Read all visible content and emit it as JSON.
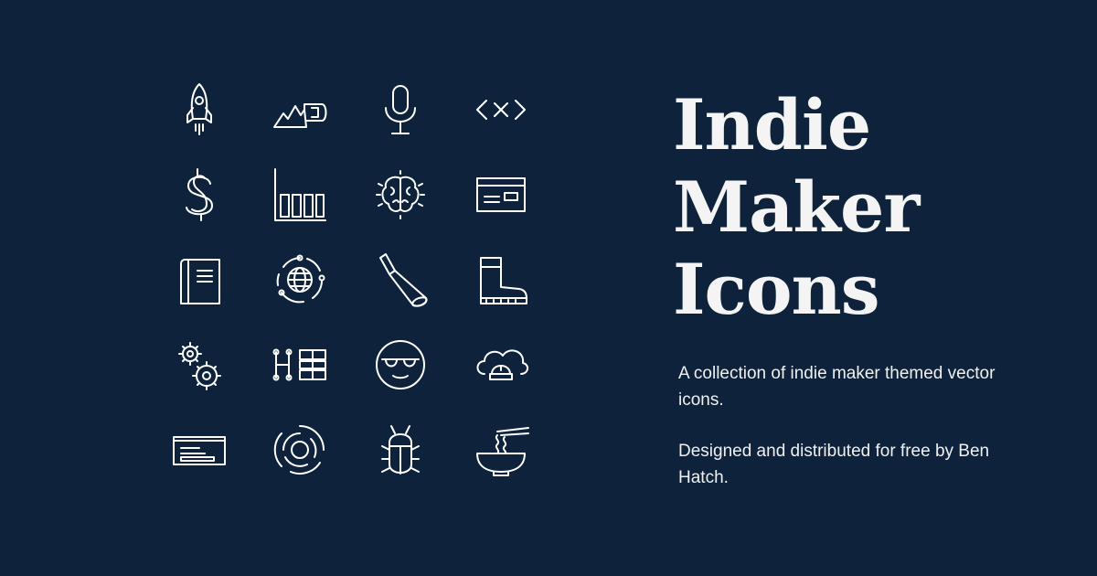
{
  "title": {
    "line1": "Indie",
    "line2": "Maker",
    "line3": "Icons"
  },
  "description": {
    "paragraph1": "A collection of indie maker themed vector icons.",
    "paragraph2": "Designed and distributed for free by Ben Hatch."
  },
  "icons": [
    "rocket-icon",
    "mountain-flag-icon",
    "microphone-icon",
    "code-brackets-icon",
    "dollar-icon",
    "bar-chart-icon",
    "brain-icon",
    "browser-window-icon",
    "book-icon",
    "globe-orbit-icon",
    "flashlight-icon",
    "boot-icon",
    "gears-icon",
    "kanban-board-icon",
    "sunglasses-face-icon",
    "cloud-dome-icon",
    "keyboard-icon",
    "target-rings-icon",
    "bug-icon",
    "ramen-bowl-icon"
  ],
  "colors": {
    "background": "#0e233b",
    "foreground": "#ffffff"
  }
}
